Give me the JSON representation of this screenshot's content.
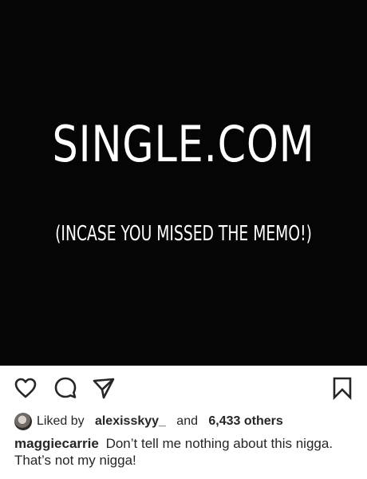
{
  "post": {
    "headline": "SINGLE.COM",
    "subline": "(INCASE YOU MISSED THE MEMO!)"
  },
  "actions": {
    "like_icon": "heart-icon",
    "comment_icon": "comment-bubble-icon",
    "share_icon": "send-icon",
    "save_icon": "bookmark-icon"
  },
  "likes": {
    "prefix": "Liked by",
    "username": "alexisskyy_",
    "joiner": "and",
    "count": "6,433 others"
  },
  "caption": {
    "username": "maggiecarrie",
    "text": "Don’t tell me nothing about this nigga. That’s not my nigga!"
  },
  "colors": {
    "image_background": "#050505",
    "text_primary": "#262626",
    "icon_stroke": "#262626"
  }
}
